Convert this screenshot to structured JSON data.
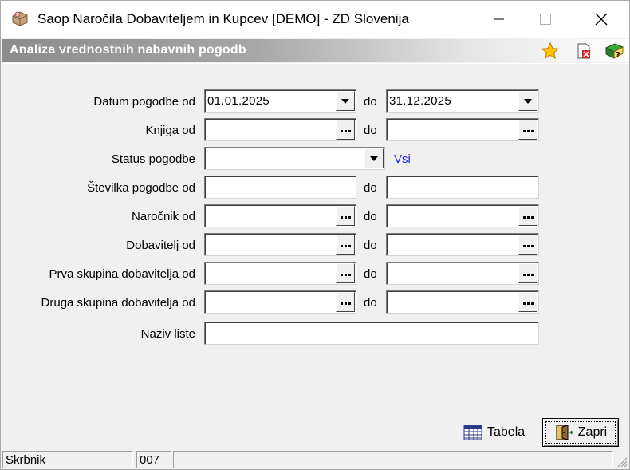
{
  "window": {
    "title": "Saop Naročila Dobaviteljem in Kupcev [DEMO] - ZD Slovenija"
  },
  "header": {
    "title": "Analiza vrednostnih nabavnih pogodb",
    "icons": [
      "star-icon",
      "close-document-icon",
      "help-book-icon"
    ]
  },
  "form": {
    "separator_label": "do",
    "rows": [
      {
        "label": "Datum pogodbe od",
        "from": "01.01.2025",
        "to": "31.12.2025",
        "type": "dropdown-range"
      },
      {
        "label": "Knjiga od",
        "from": "",
        "to": "",
        "type": "lookup-range"
      },
      {
        "label": "Status pogodbe",
        "value": "",
        "type": "dropdown",
        "hint": "Vsi"
      },
      {
        "label": "Številka pogodbe od",
        "from": "",
        "to": "",
        "type": "text-range"
      },
      {
        "label": "Naročnik od",
        "from": "",
        "to": "",
        "type": "lookup-range"
      },
      {
        "label": "Dobavitelj od",
        "from": "",
        "to": "",
        "type": "lookup-range"
      },
      {
        "label": "Prva skupina dobavitelja od",
        "from": "",
        "to": "",
        "type": "lookup-range"
      },
      {
        "label": "Druga skupina dobavitelja od",
        "from": "",
        "to": "",
        "type": "lookup-range"
      },
      {
        "label": "Naziv liste",
        "value": "",
        "type": "text"
      }
    ]
  },
  "buttons": {
    "tabela": "Tabela",
    "zapri": "Zapri"
  },
  "status_bar": {
    "user": "Skrbnik",
    "code": "007",
    "extra": ""
  },
  "colors": {
    "header_gradient_start": "#8c8c8c",
    "hint_link": "#1a1aff",
    "window_bg": "#f0f0f0"
  }
}
